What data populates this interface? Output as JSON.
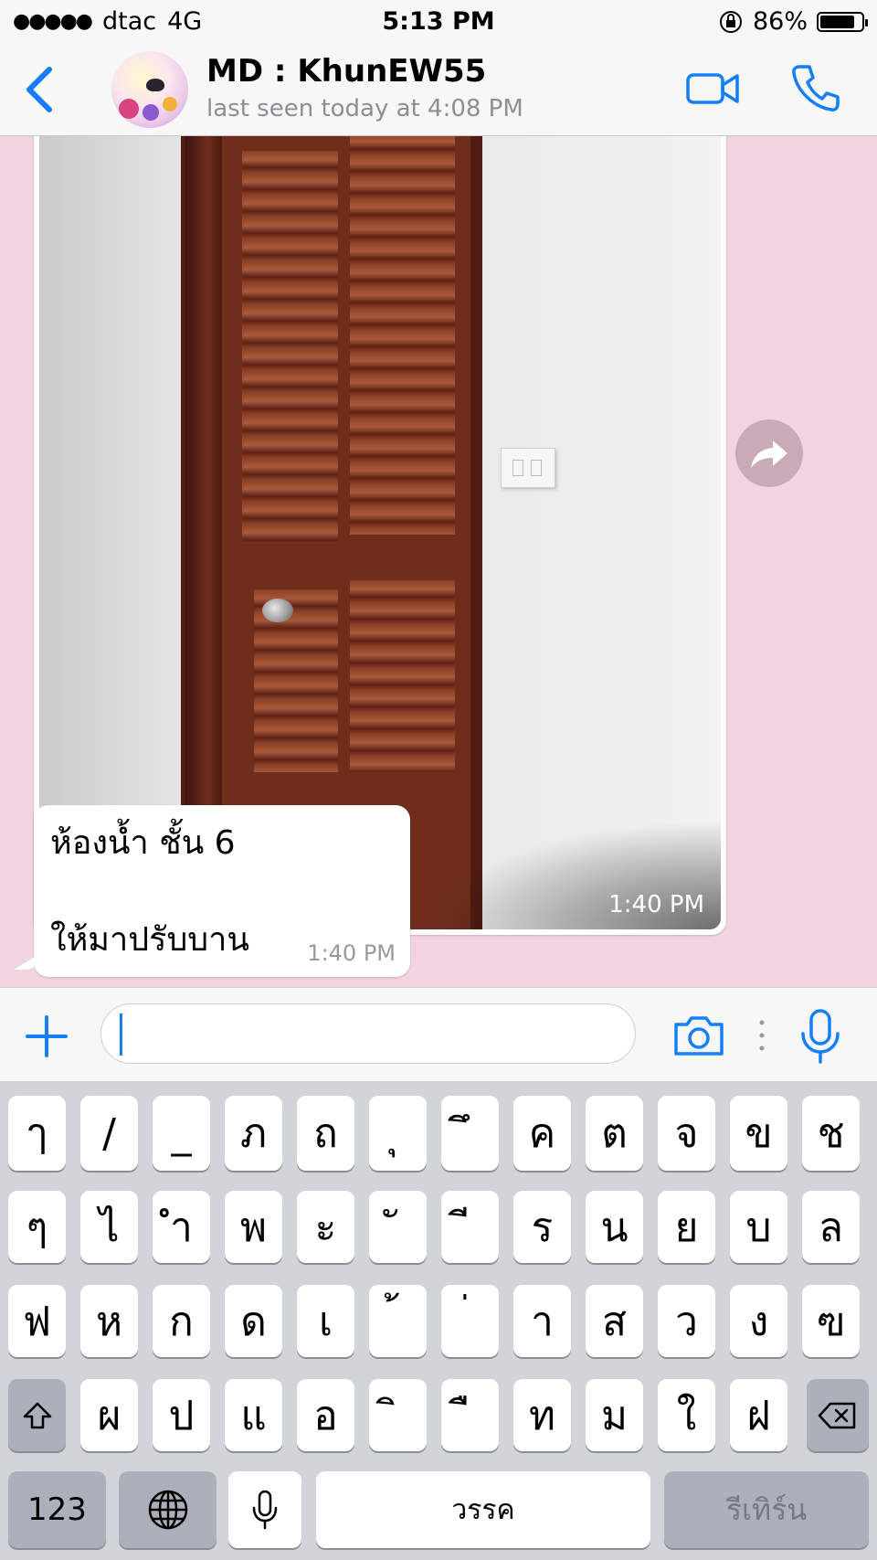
{
  "status_bar": {
    "signal_dots": "●●●●●",
    "carrier": "dtac",
    "network": "4G",
    "time": "5:13 PM",
    "battery_percent": "86%",
    "battery_level": 0.86
  },
  "header": {
    "contact_name": "MD : KhunEW55",
    "last_seen": "last seen today at 4:08 PM"
  },
  "messages": {
    "image_time": "1:40 PM",
    "text_line1": "ห้องน้ำ ชั้น 6",
    "text_line2": "ให้มาปรับบาน",
    "text_time": "1:40 PM"
  },
  "input": {
    "value": ""
  },
  "keyboard": {
    "row1": [
      "ๅ",
      "/",
      "_",
      "ภ",
      "ถ",
      "ุ",
      "ึ",
      "ค",
      "ต",
      "จ",
      "ข",
      "ช"
    ],
    "row2": [
      "ๆ",
      "ไ",
      "ำ",
      "พ",
      "ะ",
      "ั",
      "ี",
      "ร",
      "น",
      "ย",
      "บ",
      "ล"
    ],
    "row3": [
      "ฟ",
      "ห",
      "ก",
      "ด",
      "เ",
      "้",
      "่",
      "า",
      "ส",
      "ว",
      "ง",
      "ฃ"
    ],
    "row4": [
      "ผ",
      "ป",
      "แ",
      "อ",
      "ิ",
      "ื",
      "ท",
      "ม",
      "ใ",
      "ฝ"
    ],
    "numbers_label": "123",
    "space_label": "วรรค",
    "return_label": "รีเทิร์น"
  }
}
